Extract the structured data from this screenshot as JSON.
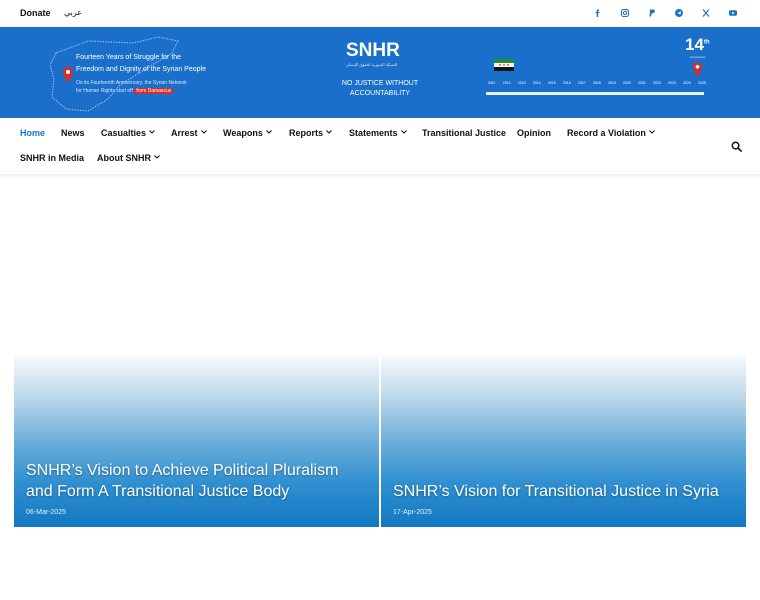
{
  "topbar": {
    "donate_label": "Donate",
    "arabic_label": "عربي",
    "socials": [
      "facebook-icon",
      "instagram-icon",
      "paypal-icon",
      "telegram-icon",
      "x-icon",
      "youtube-icon"
    ]
  },
  "banner": {
    "headline_line1": "Fourteen Years of Struggle for the",
    "headline_line2": "Freedom and Dignity of the Syrian People",
    "sub_line1": "On its Fourteenth Anniversary, the Syrian Network",
    "sub_line2": "for Human Rights start off",
    "sub_highlight": "from Damascus",
    "logo_text": "SNHR",
    "logo_arabic": "الشبكة السورية لحقوق الإنسان",
    "slogan_line1": "NO JUSTICE WITHOUT",
    "slogan_line2": "ACCOUNTABILITY",
    "anniversary_number": "14",
    "anniversary_sup": "th",
    "anniversary_sub": "Anniversary",
    "years": [
      "2011",
      "2012",
      "2013",
      "2014",
      "2015",
      "2016",
      "2017",
      "2018",
      "2019",
      "2020",
      "2021",
      "2022",
      "2023",
      "2024",
      "2025"
    ]
  },
  "nav": {
    "items": [
      {
        "label": "Home",
        "active": true,
        "dropdown": false
      },
      {
        "label": "News",
        "active": false,
        "dropdown": false
      },
      {
        "label": "Casualties",
        "active": false,
        "dropdown": true
      },
      {
        "label": "Arrest",
        "active": false,
        "dropdown": true
      },
      {
        "label": "Weapons",
        "active": false,
        "dropdown": true
      },
      {
        "label": "Reports",
        "active": false,
        "dropdown": true
      },
      {
        "label": "Statements",
        "active": false,
        "dropdown": true
      },
      {
        "label": "Transitional Justice",
        "active": false,
        "dropdown": false
      },
      {
        "label": "Opinion",
        "active": false,
        "dropdown": false
      },
      {
        "label": "Record a Violation",
        "active": false,
        "dropdown": true
      },
      {
        "label": "SNHR in Media",
        "active": false,
        "dropdown": false
      },
      {
        "label": "About SNHR",
        "active": false,
        "dropdown": true
      }
    ]
  },
  "cards": [
    {
      "title_line1": "SNHR’s Vision to Achieve Political Pluralism",
      "title_line2": "and Form A Transitional Justice Body",
      "date": "06-Mar-2025"
    },
    {
      "title_line1": "SNHR’s Vision for Transitional Justice in Syria",
      "title_line2": "",
      "date": "17-Apr-2025"
    }
  ],
  "colors": {
    "accent": "#1a73c7",
    "banner": "#1a6fcb",
    "pin": "#d32f2f"
  }
}
